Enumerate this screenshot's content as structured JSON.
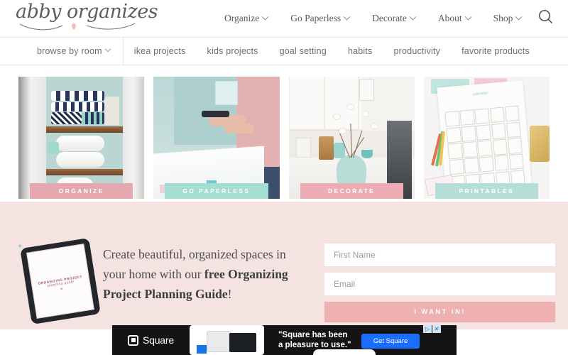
{
  "site": {
    "logo_text": "abby organizes",
    "logo_icon": "heart-icon"
  },
  "header": {
    "nav": [
      {
        "label": "Organize",
        "has_dropdown": true
      },
      {
        "label": "Go Paperless",
        "has_dropdown": true
      },
      {
        "label": "Decorate",
        "has_dropdown": true
      },
      {
        "label": "About",
        "has_dropdown": true
      },
      {
        "label": "Shop",
        "has_dropdown": true
      }
    ],
    "search_icon": "search-icon"
  },
  "subnav": {
    "items": [
      {
        "label": "browse by room",
        "has_dropdown": true
      },
      {
        "label": "ikea projects",
        "has_dropdown": false
      },
      {
        "label": "kids projects",
        "has_dropdown": false
      },
      {
        "label": "goal setting",
        "has_dropdown": false
      },
      {
        "label": "habits",
        "has_dropdown": false
      },
      {
        "label": "productivity",
        "has_dropdown": false
      },
      {
        "label": "favorite products",
        "has_dropdown": false
      }
    ]
  },
  "cards": [
    {
      "label": "ORGANIZE",
      "color": "#e5a8b0",
      "art": "linen-closet-towels"
    },
    {
      "label": "GO PAPERLESS",
      "color": "#a4ddd2",
      "art": "person-holding-phone-at-desk"
    },
    {
      "label": "DECORATE",
      "color": "#eeacb4",
      "art": "white-kitchen-with-vase"
    },
    {
      "label": "PRINTABLES",
      "color": "#b6ded8",
      "art": "printable-calendar-on-desk"
    }
  ],
  "optin": {
    "headline_part1": "Create beautiful, organized spaces in your home with our ",
    "headline_bold": "free Organizing Project Planning Guide",
    "headline_end": "!",
    "device": {
      "line1": "ORGANIZING PROJECT",
      "line2": "planning guide",
      "icon": "heart-icon"
    },
    "first_name_placeholder": "First Name",
    "first_name_value": "",
    "email_placeholder": "Email",
    "email_value": "",
    "submit_label": "I WANT IN!",
    "bg_color": "#f4e3e1",
    "submit_color": "#eeb0b0"
  },
  "ad": {
    "brand": "Square",
    "brand_icon": "square-logo-icon",
    "quote_line1": "\"Square has been",
    "quote_line2": "a pleasure to use.\"",
    "cta_label": "Get Square",
    "cta_color": "#1a6dff",
    "adchoices_icon": "adchoices-icon",
    "close_icon": "close-icon",
    "close_label": "✕",
    "adchoices_label": "▷"
  }
}
